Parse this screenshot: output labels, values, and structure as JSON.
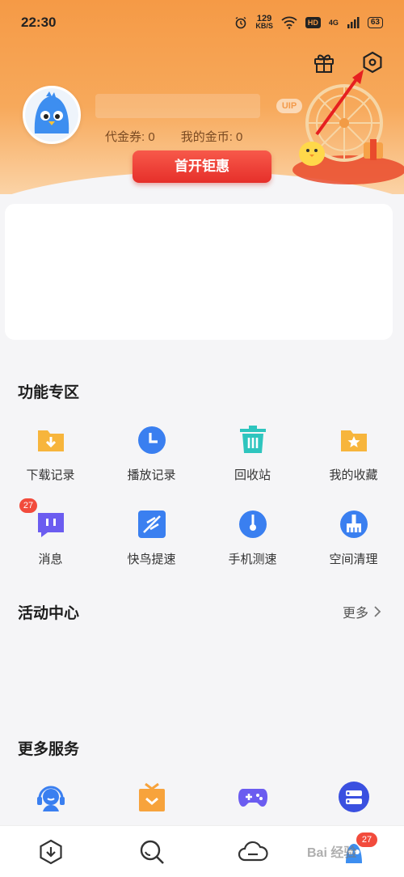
{
  "status_bar": {
    "time": "22:30",
    "speed_value": "129",
    "speed_unit": "KB/S",
    "hd": "HD",
    "network": "4G",
    "battery": "63",
    "icons": [
      "alarm-icon",
      "wifi-icon",
      "signal-icon",
      "battery-icon"
    ]
  },
  "header": {
    "icons": [
      "gift-icon",
      "settings-hexagon-icon"
    ],
    "vip_tag": "UIP",
    "coupon_label": "代金券: 0",
    "coins_label": "我的金币: 0",
    "open_button": "首开钜惠"
  },
  "features": {
    "title": "功能专区",
    "items": [
      {
        "label": "下载记录",
        "icon": "download-folder-icon",
        "color": "#f7b53c"
      },
      {
        "label": "播放记录",
        "icon": "clock-icon",
        "color": "#3a7ff0"
      },
      {
        "label": "回收站",
        "icon": "trash-icon",
        "color": "#2ec5be"
      },
      {
        "label": "我的收藏",
        "icon": "star-folder-icon",
        "color": "#f7b53c"
      },
      {
        "label": "消息",
        "icon": "message-icon",
        "color": "#6b5cf0",
        "badge": "27"
      },
      {
        "label": "快鸟提速",
        "icon": "bird-speed-icon",
        "color": "#3a7ff0"
      },
      {
        "label": "手机测速",
        "icon": "speedometer-icon",
        "color": "#3a7ff0"
      },
      {
        "label": "空间清理",
        "icon": "broom-icon",
        "color": "#3a7ff0"
      }
    ]
  },
  "activity": {
    "title": "活动中心",
    "more": "更多"
  },
  "services": {
    "title": "更多服务",
    "items": [
      {
        "icon": "headset-service-icon",
        "color": "#3a7ff0"
      },
      {
        "icon": "gift-box-icon",
        "color": "#f7a33c"
      },
      {
        "icon": "gamepad-icon",
        "color": "#6b5cf0"
      },
      {
        "icon": "list-circle-icon",
        "color": "#3a50e0"
      }
    ]
  },
  "bottom_nav": {
    "items": [
      {
        "icon": "download-nav-icon"
      },
      {
        "icon": "search-nav-icon"
      },
      {
        "icon": "cloud-nav-icon"
      },
      {
        "icon": "profile-nav-icon",
        "badge": "27"
      }
    ]
  },
  "watermark": "Bai 经验"
}
